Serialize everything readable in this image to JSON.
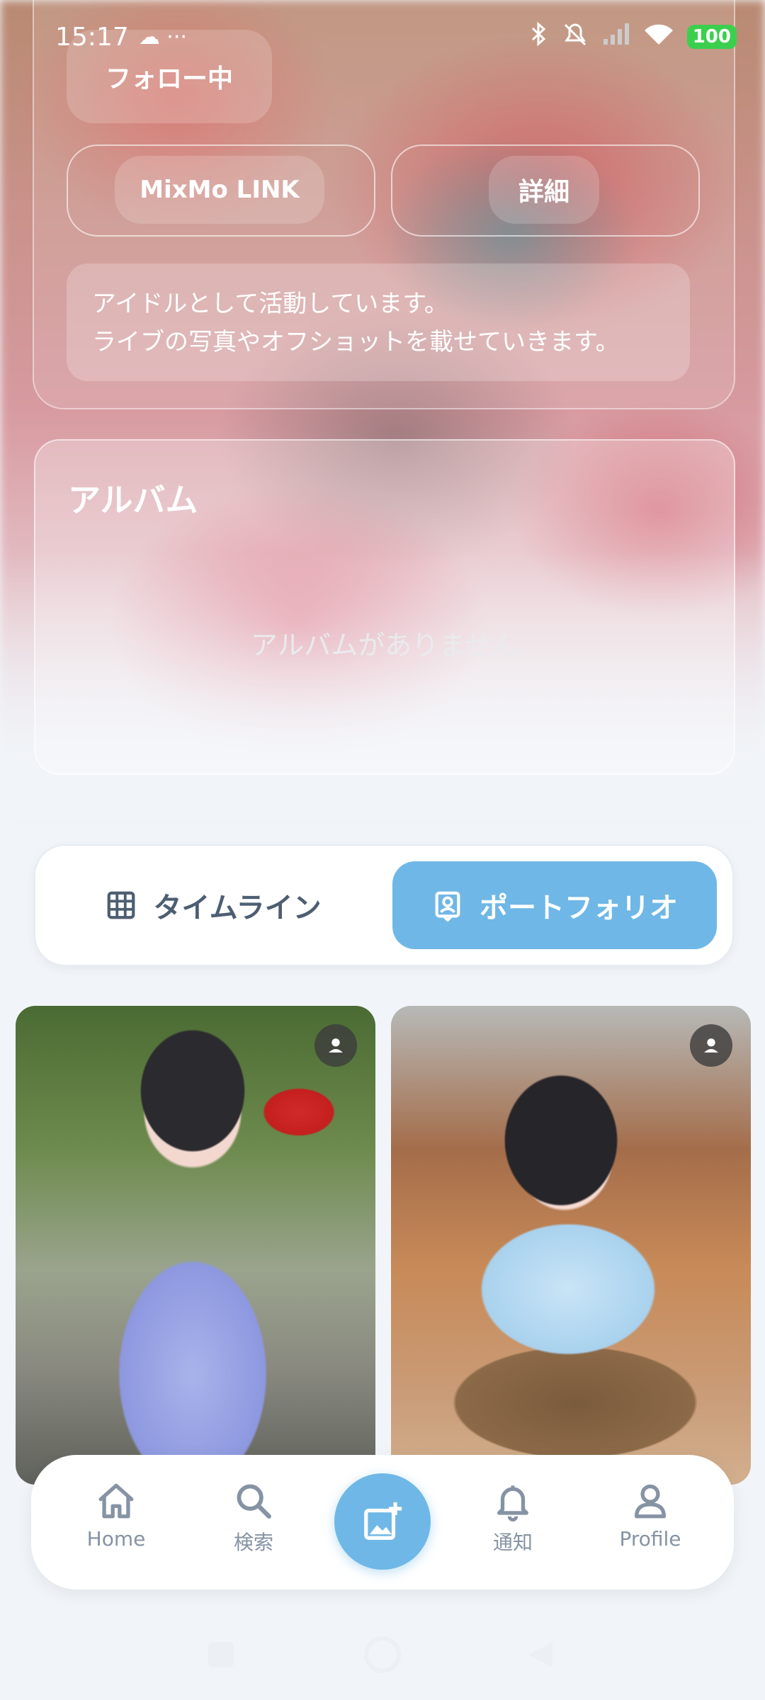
{
  "status_bar": {
    "time": "15:17",
    "extra": "☁ ···",
    "battery": "100"
  },
  "profile": {
    "follow_button": "フォロー中",
    "link_button": "MixMo LINK",
    "detail_button": "詳細",
    "bio_line1": "アイドルとして活動しています。",
    "bio_line2": "ライブの写真やオフショットを載せていきます。"
  },
  "album": {
    "title": "アルバム",
    "empty_message": "アルバムがありません"
  },
  "tabs": {
    "timeline": "タイムライン",
    "portfolio": "ポートフォリオ"
  },
  "bottom_nav": {
    "home": "Home",
    "search": "検索",
    "notifications": "通知",
    "profile": "Profile"
  },
  "colors": {
    "accent": "#6fb7e6",
    "nav_text": "#8593a4"
  },
  "icons": [
    "cloud-icon",
    "bluetooth-icon",
    "mute-icon",
    "signal-icon",
    "wifi-icon",
    "grid-icon",
    "portfolio-icon",
    "person-badge-icon",
    "home-icon",
    "search-icon",
    "add-image-icon",
    "bell-icon",
    "profile-icon"
  ]
}
